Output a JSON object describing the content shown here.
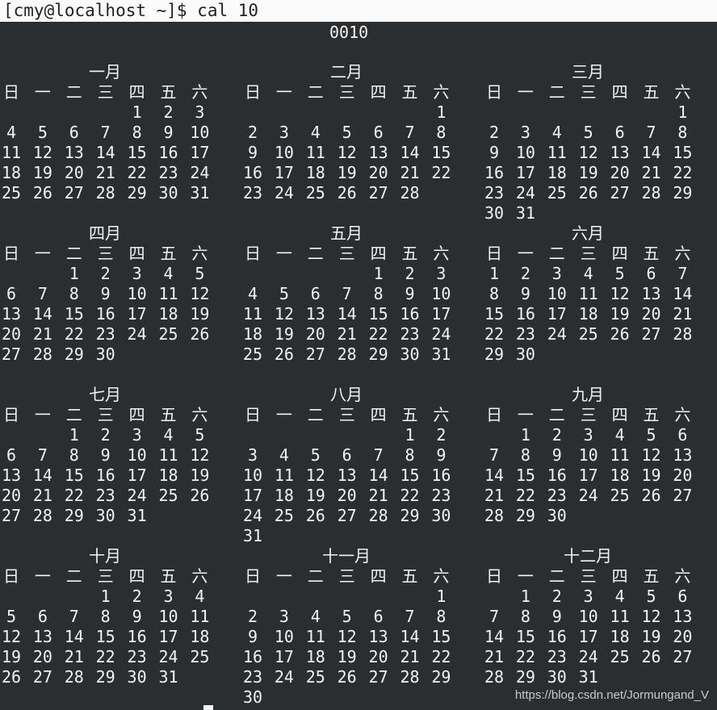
{
  "terminal": {
    "prompt": "[cmy@localhost ~]$ cal 10",
    "year": "0010"
  },
  "weekday_headers": [
    "日",
    "一",
    "二",
    "三",
    "四",
    "五",
    "六"
  ],
  "months": [
    {
      "title": "一月",
      "start": 4,
      "days": 31
    },
    {
      "title": "二月",
      "start": 6,
      "days": 28
    },
    {
      "title": "三月",
      "start": 6,
      "days": 31
    },
    {
      "title": "四月",
      "start": 2,
      "days": 30
    },
    {
      "title": "五月",
      "start": 4,
      "days": 31
    },
    {
      "title": "六月",
      "start": 0,
      "days": 30
    },
    {
      "title": "七月",
      "start": 2,
      "days": 31
    },
    {
      "title": "八月",
      "start": 5,
      "days": 31
    },
    {
      "title": "九月",
      "start": 1,
      "days": 30
    },
    {
      "title": "十月",
      "start": 3,
      "days": 31
    },
    {
      "title": "十一月",
      "start": 6,
      "days": 30
    },
    {
      "title": "十二月",
      "start": 1,
      "days": 31
    }
  ],
  "watermark": "https://blog.csdn.net/Jormungand_V"
}
